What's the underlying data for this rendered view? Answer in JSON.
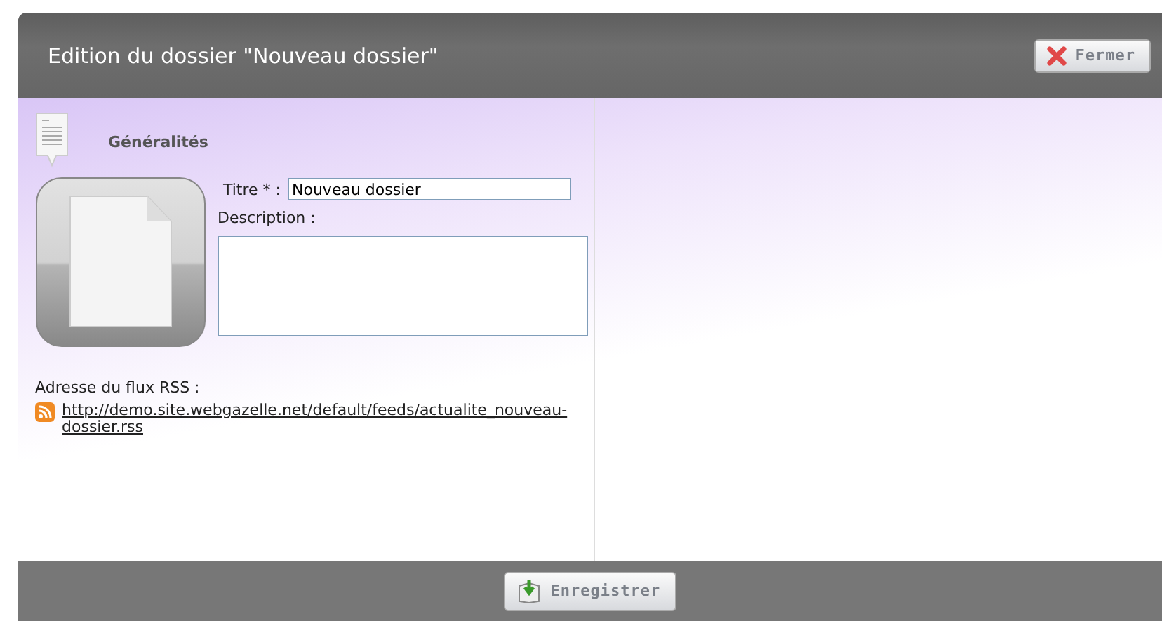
{
  "dialog": {
    "title": "Edition du dossier \"Nouveau dossier\"",
    "close_button": "Fermer"
  },
  "section": {
    "title": "Généralités"
  },
  "form": {
    "title_label": "Titre * :",
    "title_value": "Nouveau dossier",
    "description_label": "Description :",
    "rss_label": "Adresse du flux RSS :",
    "rss_link": "http://demo.site.webgazelle.net/default/feeds/actualite_nouveau-dossier.rss"
  },
  "footer": {
    "save_button": "Enregistrer"
  }
}
